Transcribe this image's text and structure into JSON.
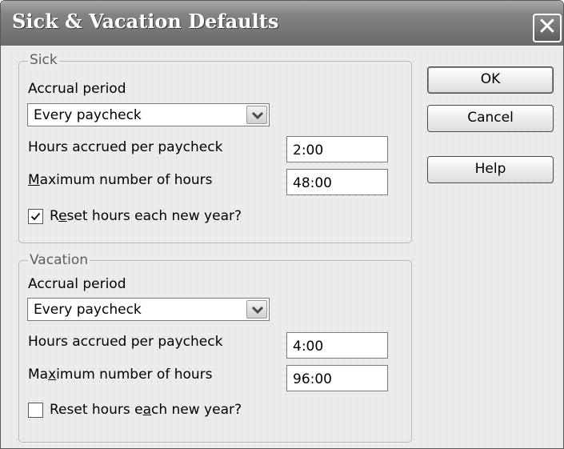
{
  "window": {
    "title": "Sick & Vacation Defaults",
    "close_glyph": "✕"
  },
  "sick": {
    "legend": "Sick",
    "accrual_label": "Accrual period",
    "accrual_value": "Every paycheck",
    "hours_accrued_label": "Hours accrued per paycheck",
    "hours_accrued_value": "2:00",
    "max_hours_label": {
      "pre": "",
      "key": "M",
      "post": "aximum number of hours"
    },
    "max_hours_value": "48:00",
    "reset": {
      "label_pre": "R",
      "label_key": "e",
      "label_post": "set hours each new year?",
      "checked": true
    }
  },
  "vacation": {
    "legend": "Vacation",
    "accrual_label": "Accrual period",
    "accrual_value": "Every paycheck",
    "hours_accrued_label": "Hours accrued per paycheck",
    "hours_accrued_value": "4:00",
    "max_hours_label": {
      "pre": "Ma",
      "key": "x",
      "post": "imum number of hours"
    },
    "max_hours_value": "96:00",
    "reset": {
      "label_pre": "Reset hours e",
      "label_key": "a",
      "label_post": "ch new year?",
      "checked": false
    }
  },
  "buttons": {
    "ok": "OK",
    "cancel": "Cancel",
    "help": "Help"
  },
  "icons": {
    "close": "close-icon",
    "dropdown": "chevron-down-icon",
    "checkmark": "checkmark-icon"
  },
  "colors": {
    "titlebar": "#6a6a6a",
    "window_bg": "#ececec",
    "text": "#000000"
  }
}
